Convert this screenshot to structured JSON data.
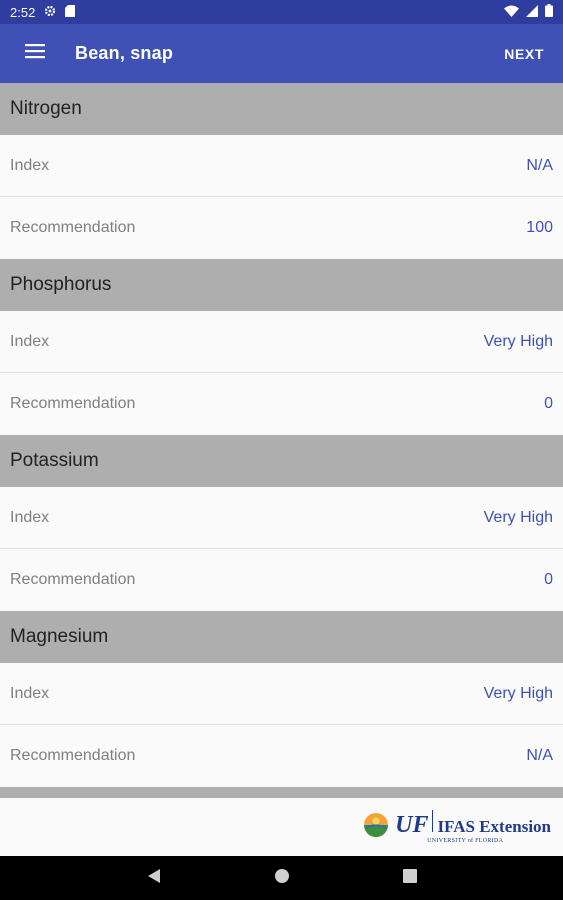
{
  "status_bar": {
    "time": "2:52",
    "icons": [
      "settings-icon",
      "sd-card-icon",
      "wifi-icon",
      "cell-signal-icon",
      "battery-icon"
    ]
  },
  "app_bar": {
    "title": "Bean, snap",
    "next_label": "NEXT",
    "menu_icon": "hamburger-menu-icon"
  },
  "sections": [
    {
      "title": "Nitrogen",
      "index_label": "Index",
      "index_value": "N/A",
      "rec_label": "Recommendation",
      "rec_value": "100"
    },
    {
      "title": "Phosphorus",
      "index_label": "Index",
      "index_value": "Very High",
      "rec_label": "Recommendation",
      "rec_value": "0"
    },
    {
      "title": "Potassium",
      "index_label": "Index",
      "index_value": "Very High",
      "rec_label": "Recommendation",
      "rec_value": "0"
    },
    {
      "title": "Magnesium",
      "index_label": "Index",
      "index_value": "Very High",
      "rec_label": "Recommendation",
      "rec_value": "N/A"
    }
  ],
  "footer": {
    "logo_uf": "UF",
    "logo_ifas": "IFAS Extension",
    "logo_university": "UNIVERSITY of FLORIDA"
  },
  "nav_bar": {
    "icons": [
      "back-icon",
      "home-icon",
      "recents-icon"
    ]
  },
  "colors": {
    "app_bar": "#3f51b5",
    "status_bar": "#2e3d9e",
    "section_header": "#aeaeae",
    "value_text": "#3f51b5",
    "label_text": "#808080"
  }
}
